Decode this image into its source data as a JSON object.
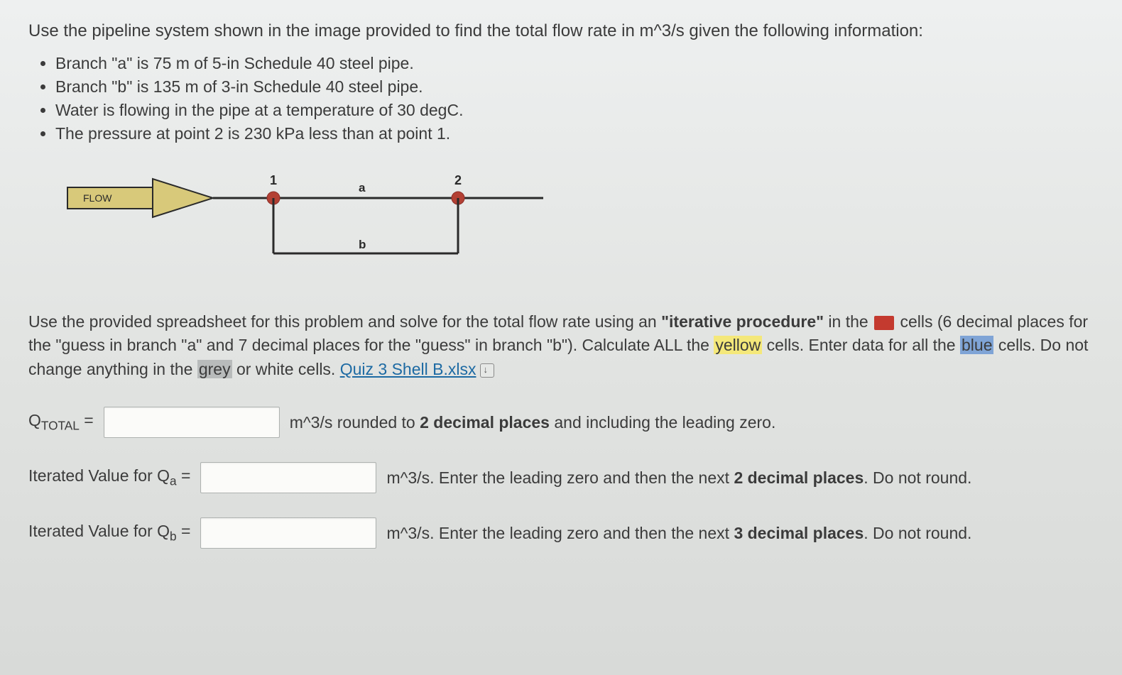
{
  "intro": "Use the pipeline system shown in the image provided to find the total flow rate in m^3/s given the following information:",
  "bullets": [
    "Branch \"a\" is 75 m of 5-in Schedule 40 steel pipe.",
    "Branch \"b\" is 135 m of 3-in Schedule 40 steel pipe.",
    "Water is flowing in the pipe at a temperature of 30 degC.",
    "The pressure at point 2 is 230 kPa less than at point 1."
  ],
  "diagram": {
    "flow_label": "FLOW",
    "node1": "1",
    "node2": "2",
    "branch_a": "a",
    "branch_b": "b"
  },
  "instr": {
    "p1a": "Use the provided spreadsheet for this problem and solve for the total flow rate using an ",
    "p1b": "\"iterative procedure\"",
    "p1c": " in the ",
    "p1d": " cells (6 decimal places for the \"guess in branch \"a\" and 7 decimal places for the \"guess\" in branch \"b\"). Calculate ALL the ",
    "yellow": "yellow",
    "p1e": " cells.  Enter data for all the ",
    "blue": "blue",
    "p1f": " cells. Do not change anything in the ",
    "grey": "grey",
    "p1g": " or white cells.  ",
    "link": "Quiz 3 Shell B.xlsx"
  },
  "answers": {
    "q_total_label_pre": "Q",
    "q_total_label_sub": "TOTAL",
    "q_total_label_post": " = ",
    "q_total_tail_a": "m^3/s rounded to ",
    "q_total_tail_b": "2 decimal places",
    "q_total_tail_c": " and including the leading zero.",
    "qa_label_pre": "Iterated Value for Q",
    "qa_label_sub": "a",
    "qa_label_post": " = ",
    "qa_tail_a": "m^3/s. Enter the leading zero and then the next ",
    "qa_tail_b": "2 decimal places",
    "qa_tail_c": ". Do not round.",
    "qb_label_pre": "Iterated Value for Q",
    "qb_label_sub": "b",
    "qb_label_post": " = ",
    "qb_tail_a": "m^3/s. Enter the leading zero and then the next ",
    "qb_tail_b": "3 decimal places",
    "qb_tail_c": ". Do not round."
  }
}
